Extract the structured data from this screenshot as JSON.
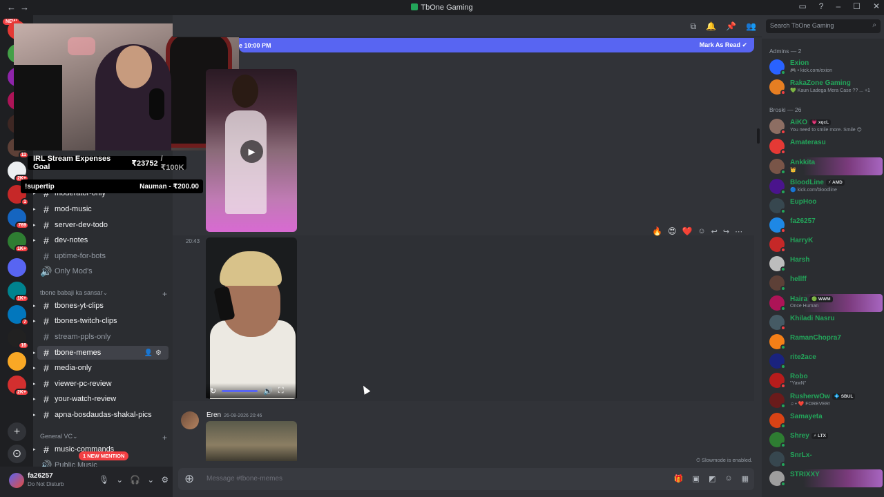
{
  "window": {
    "title": "TbOne Gaming",
    "back_icon": "←",
    "forward_icon": "→"
  },
  "guilds": {
    "new_label": "NEW",
    "items": [
      {
        "badge": "",
        "color": "#e53935"
      },
      {
        "badge": "",
        "color": "#43a047"
      },
      {
        "badge": "",
        "color": "#8e24aa"
      },
      {
        "badge": "",
        "color": "#ad1457"
      },
      {
        "badge": "289",
        "color": "#3e2723"
      },
      {
        "badge": "11",
        "color": "#5d4037"
      },
      {
        "badge": "2K+",
        "color": "#eceff1"
      },
      {
        "badge": "1",
        "color": "#c62828"
      },
      {
        "badge": "769",
        "color": "#1565c0"
      },
      {
        "badge": "1K+",
        "color": "#2e7d32"
      },
      {
        "badge": "",
        "color": "#5865f2"
      },
      {
        "badge": "1K+",
        "color": "#00838f"
      },
      {
        "badge": "7",
        "color": "#0277bd"
      },
      {
        "badge": "16",
        "color": "#212121"
      },
      {
        "badge": "",
        "color": "#f9a825"
      },
      {
        "badge": "2K+",
        "color": "#d32f2f"
      }
    ]
  },
  "stream_overlay": {
    "goal_label": "IRL Stream Expenses Goal",
    "goal_current": "₹23752",
    "goal_total": "/ ₹100K",
    "tip_command": "!supertip",
    "tip_donor": "Nauman - ₹200.00"
  },
  "channels": {
    "items": [
      {
        "name": "moderator-only",
        "state": "unread",
        "dot": true
      },
      {
        "name": "mod-music",
        "state": "unread",
        "dot": true
      },
      {
        "name": "server-dev-todo",
        "state": "unread",
        "dot": true
      },
      {
        "name": "dev-notes",
        "state": "unread",
        "dot": true
      },
      {
        "name": "uptime-for-bots",
        "state": "muted",
        "dot": false
      },
      {
        "name": "Only Mod's",
        "state": "muted",
        "dot": false,
        "voice": true
      }
    ],
    "category1": "tbone babaji ka sansar",
    "items2": [
      {
        "name": "tbones-yt-clips",
        "state": "unread",
        "dot": true
      },
      {
        "name": "tbones-twitch-clips",
        "state": "unread",
        "dot": true
      },
      {
        "name": "stream-ppls-only",
        "state": "muted",
        "dot": false
      },
      {
        "name": "tbone-memes",
        "state": "active",
        "dot": true
      },
      {
        "name": "media-only",
        "state": "unread",
        "dot": true
      },
      {
        "name": "viewer-pc-review",
        "state": "unread",
        "dot": true
      },
      {
        "name": "your-watch-review",
        "state": "unread",
        "dot": true
      },
      {
        "name": "apna-bosdaudas-shakal-pics",
        "state": "unread",
        "dot": true
      }
    ],
    "category2": "General VC",
    "items3": [
      {
        "name": "music-commands",
        "state": "unread",
        "dot": true
      },
      {
        "name": "Public Music",
        "state": "muted",
        "dot": false,
        "voice": true
      }
    ],
    "mention_pill": "1 NEW MENTION"
  },
  "user_panel": {
    "name": "fa26257",
    "status": "Do Not Disturb"
  },
  "header": {
    "search_placeholder": "Search TbOne Gaming"
  },
  "new_messages_bar": {
    "since": "e 10:00 PM",
    "mark_read": "Mark As Read"
  },
  "messages": {
    "time_2043": "20:43",
    "eren_name": "Eren",
    "eren_timestamp": "26-08-2026 20:46",
    "slowmode": "Slowmode is enabled.",
    "composer_placeholder": "Message #tbone-memes"
  },
  "reactions": [
    "🔥",
    "😍",
    "❤️"
  ],
  "members": {
    "admins_header": "Admins — 2",
    "broski_header": "Broski — 26",
    "admins": [
      {
        "name": "Exion",
        "sub": "🎮 • kick.com/exion",
        "color": "#23a55a",
        "av": "#2962ff",
        "status": "#23a55a"
      },
      {
        "name": "RakaZone Gaming",
        "sub": "💚 Kaun Ladega Mera Case ?? ... +1",
        "color": "#23a55a",
        "av": "#e67e22",
        "status": "#f23f43"
      }
    ],
    "broski": [
      {
        "name": "AiKO",
        "tag": "💗 xqcL",
        "sub": "You need to smile more. Smile 😊",
        "color": "#23a55a",
        "av": "#8d6e63",
        "status": "#f23f43"
      },
      {
        "name": "Amaterasu",
        "tag": "",
        "sub": "",
        "color": "#23a55a",
        "av": "#e53935",
        "status": "#f23f43"
      },
      {
        "name": "Ankkita",
        "tag": "",
        "sub": "👑",
        "color": "#23a55a",
        "av": "#795548",
        "status": "#23a55a",
        "banner": true
      },
      {
        "name": "BloodLine",
        "tag": "⚡ AMD",
        "sub": "🔵 kick.com/bloodline",
        "color": "#23a55a",
        "av": "#4a148c",
        "status": "#23a55a"
      },
      {
        "name": "EupHoo",
        "tag": "",
        "sub": "",
        "color": "#23a55a",
        "av": "#37474f",
        "status": "#23a55a"
      },
      {
        "name": "fa26257",
        "tag": "",
        "sub": "",
        "color": "#23a55a",
        "av": "#1e88e5",
        "status": "#f23f43"
      },
      {
        "name": "HarryK",
        "tag": "",
        "sub": "",
        "color": "#23a55a",
        "av": "#c62828",
        "status": "#f23f43"
      },
      {
        "name": "Harsh",
        "tag": "",
        "sub": "",
        "color": "#23a55a",
        "av": "#bdbdbd",
        "status": "#23a55a"
      },
      {
        "name": "hellff",
        "tag": "",
        "sub": "",
        "color": "#23a55a",
        "av": "#5d4037",
        "status": "#23a55a"
      },
      {
        "name": "Haira",
        "tag": "🟢 WWM",
        "sub": "Once Human",
        "color": "#23a55a",
        "av": "#ad1457",
        "status": "#23a55a",
        "banner": true
      },
      {
        "name": "Khiladi Nasru",
        "tag": "",
        "sub": "",
        "color": "#23a55a",
        "av": "#455a64",
        "status": "#f23f43"
      },
      {
        "name": "RamanChopra7",
        "tag": "",
        "sub": "",
        "color": "#23a55a",
        "av": "#f57f17",
        "status": "#23a55a"
      },
      {
        "name": "rite2ace",
        "tag": "",
        "sub": "",
        "color": "#23a55a",
        "av": "#1a237e",
        "status": "#23a55a"
      },
      {
        "name": "Robo",
        "tag": "",
        "sub": "\"YawN\"",
        "color": "#23a55a",
        "av": "#b71c1c",
        "status": "#f23f43"
      },
      {
        "name": "RusherwOw",
        "tag": "💠 SBUL",
        "sub": "♫ • ❤️ FOREVER!",
        "color": "#23a55a",
        "av": "#6a1b1b",
        "status": "#23a55a"
      },
      {
        "name": "Samayeta",
        "tag": "",
        "sub": "",
        "color": "#23a55a",
        "av": "#d84315",
        "status": "#23a55a"
      },
      {
        "name": "Shrey",
        "tag": "⚡ LTX",
        "sub": "",
        "color": "#23a55a",
        "av": "#2e7d32",
        "status": "#23a55a"
      },
      {
        "name": "SnrLx-",
        "tag": "",
        "sub": "",
        "color": "#23a55a",
        "av": "#37474f",
        "status": "#23a55a"
      },
      {
        "name": "STRIXXY",
        "tag": "",
        "sub": "",
        "color": "#23a55a",
        "av": "#9e9e9e",
        "status": "#23a55a",
        "banner": true
      }
    ]
  }
}
